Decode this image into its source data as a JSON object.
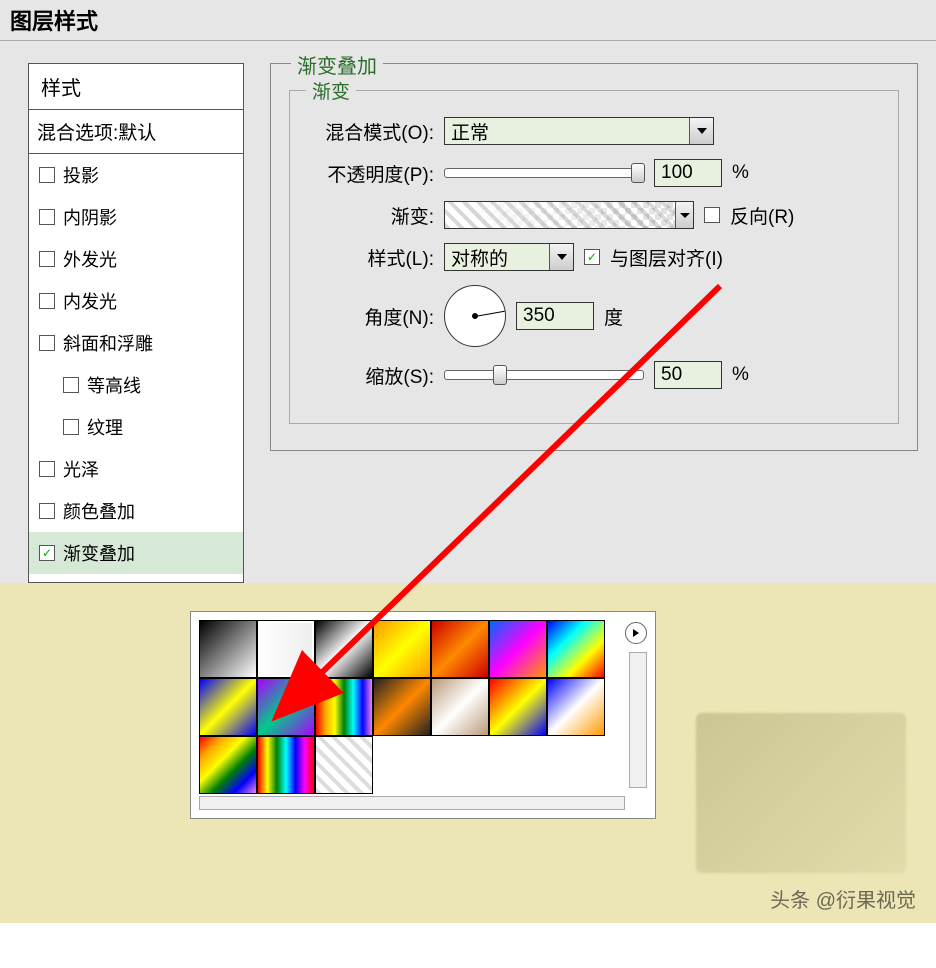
{
  "title": "图层样式",
  "styles": {
    "header": "样式",
    "blend_default": "混合选项:默认",
    "items": [
      "投影",
      "内阴影",
      "外发光",
      "内发光",
      "斜面和浮雕",
      "等高线",
      "纹理",
      "光泽",
      "颜色叠加",
      "渐变叠加"
    ],
    "selected": "渐变叠加"
  },
  "panel": {
    "title": "渐变叠加",
    "group": "渐变",
    "blend_mode_label": "混合模式(O):",
    "blend_mode_value": "正常",
    "opacity_label": "不透明度(P):",
    "opacity_value": "100",
    "opacity_unit": "%",
    "gradient_label": "渐变:",
    "reverse_label": "反向(R)",
    "style_label": "样式(L):",
    "style_value": "对称的",
    "align_label": "与图层对齐(I)",
    "angle_label": "角度(N):",
    "angle_value": "350",
    "angle_unit": "度",
    "scale_label": "缩放(S):",
    "scale_value": "50",
    "scale_unit": "%"
  },
  "watermark": "头条 @衍果视觉"
}
